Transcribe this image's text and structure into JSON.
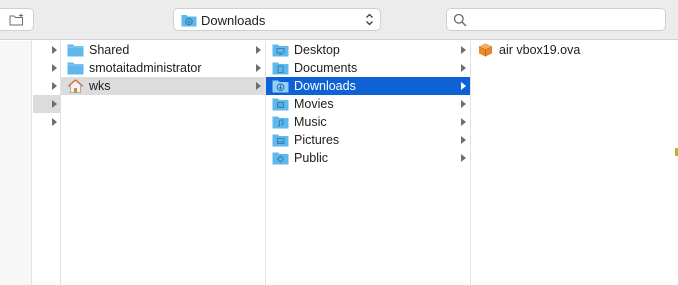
{
  "window": {
    "title": "Downloads"
  },
  "toolbar": {
    "new_folder_icon": "new-folder-icon",
    "path_popup_label": "Downloads",
    "search_placeholder": "",
    "search_value": ""
  },
  "colors": {
    "selection_blue": "#0f62d6",
    "selection_gray": "#dcdcdc",
    "folder_blue": "#5fb8ea"
  },
  "columns": {
    "users": [
      {
        "label": "Shared",
        "icon": "folder-icon",
        "has_children": true,
        "selected": false
      },
      {
        "label": "smotaitadministrator",
        "icon": "folder-icon",
        "has_children": true,
        "selected": false
      },
      {
        "label": "wks",
        "icon": "home-icon",
        "has_children": true,
        "selected": true
      }
    ],
    "home": [
      {
        "label": "Desktop",
        "icon": "desktop-folder-icon",
        "has_children": true,
        "selected": false
      },
      {
        "label": "Documents",
        "icon": "documents-folder-icon",
        "has_children": true,
        "selected": false
      },
      {
        "label": "Downloads",
        "icon": "downloads-folder-icon",
        "has_children": true,
        "selected": true
      },
      {
        "label": "Movies",
        "icon": "movies-folder-icon",
        "has_children": true,
        "selected": false
      },
      {
        "label": "Music",
        "icon": "music-folder-icon",
        "has_children": true,
        "selected": false
      },
      {
        "label": "Pictures",
        "icon": "pictures-folder-icon",
        "has_children": true,
        "selected": false
      },
      {
        "label": "Public",
        "icon": "public-folder-icon",
        "has_children": true,
        "selected": false
      }
    ],
    "downloads": [
      {
        "label": "air vbox19.ova",
        "icon": "virtualbox-appliance-icon",
        "has_children": false,
        "selected": false
      }
    ]
  }
}
